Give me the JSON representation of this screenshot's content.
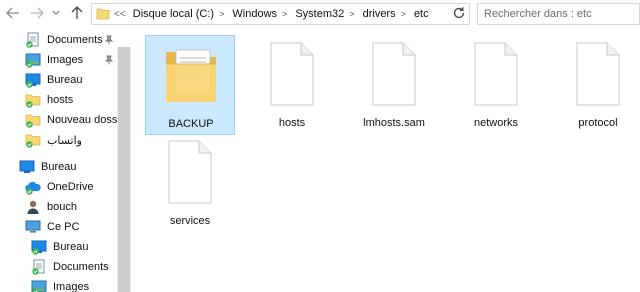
{
  "toolbar": {
    "back_icon": "arrow-left-icon",
    "forward_icon": "arrow-right-icon",
    "recent_icon": "chevron-down-icon",
    "up_icon": "arrow-up-icon"
  },
  "address": {
    "lead": "<<",
    "crumbs": [
      "Disque local (C:)",
      "Windows",
      "System32",
      "drivers",
      "etc"
    ]
  },
  "search": {
    "placeholder": "Rechercher dans : etc"
  },
  "nav": {
    "items": [
      {
        "label": "Documents",
        "icon": "documents-icon",
        "pinned": true
      },
      {
        "label": "Images",
        "icon": "images-icon",
        "pinned": true
      },
      {
        "label": "Bureau",
        "icon": "desktop-icon",
        "pinned": false
      },
      {
        "label": "hosts",
        "icon": "folder-icon",
        "pinned": false
      },
      {
        "label": "Nouveau dossier",
        "icon": "folder-icon",
        "pinned": false
      },
      {
        "label": "واتساب",
        "icon": "folder-icon",
        "pinned": false
      },
      {
        "label": "Bureau",
        "icon": "desktop-icon",
        "pinned": false
      },
      {
        "label": "OneDrive",
        "icon": "cloud-icon",
        "pinned": false
      },
      {
        "label": "bouch",
        "icon": "user-icon",
        "pinned": false
      },
      {
        "label": "Ce PC",
        "icon": "computer-icon",
        "pinned": false
      },
      {
        "label": "Bureau",
        "icon": "desktop-icon",
        "pinned": false
      },
      {
        "label": "Documents",
        "icon": "documents-icon",
        "pinned": false
      },
      {
        "label": "Images",
        "icon": "images-icon",
        "pinned": false
      }
    ]
  },
  "files": [
    {
      "name": "BACKUP",
      "type": "folder",
      "selected": true
    },
    {
      "name": "hosts",
      "type": "file",
      "selected": false
    },
    {
      "name": "lmhosts.sam",
      "type": "file",
      "selected": false
    },
    {
      "name": "networks",
      "type": "file",
      "selected": false
    },
    {
      "name": "protocol",
      "type": "file",
      "selected": false
    },
    {
      "name": "services",
      "type": "file",
      "selected": false
    }
  ],
  "colors": {
    "selection_fill": "#cce8ff",
    "selection_border": "#99d1ff",
    "folder_yellow": "#f8d775",
    "sync_green": "#3cb44b",
    "windows_blue": "#1e88e5"
  }
}
